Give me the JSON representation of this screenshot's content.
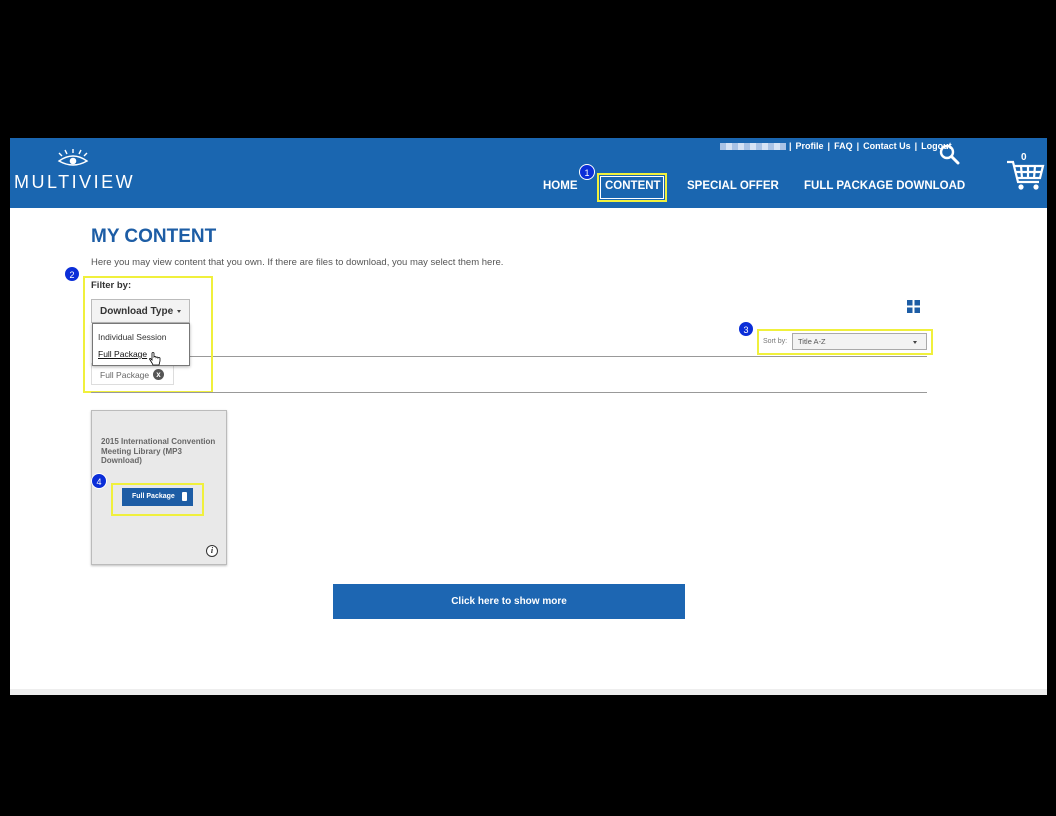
{
  "header": {
    "logo_text": "MULTIVIEW",
    "util_links": [
      "Profile",
      "FAQ",
      "Contact Us",
      "Logout"
    ],
    "cart_count": "0",
    "nav": [
      "HOME",
      "CONTENT",
      "SPECIAL OFFER",
      "FULL PACKAGE DOWNLOAD"
    ]
  },
  "page": {
    "title": "MY CONTENT",
    "intro": "Here you may view content that you own. If there are files to download, you may select them here."
  },
  "filter": {
    "label": "Filter by:",
    "dropdown_label": "Download Type",
    "options": [
      "Individual Session",
      "Full Package"
    ],
    "active_chip": "Full Package"
  },
  "sort": {
    "label": "Sort by:",
    "value": "Title A-Z"
  },
  "card": {
    "title": "2015 International Convention Meeting Library (MP3 Download)",
    "button_label": "Full Package"
  },
  "show_more_label": "Click here to show more",
  "badges": [
    "1",
    "2",
    "3",
    "4"
  ],
  "colors": {
    "brand_blue": "#1a66b0",
    "highlight_yellow": "#f0f03c",
    "badge_blue": "#0b2ed8"
  }
}
